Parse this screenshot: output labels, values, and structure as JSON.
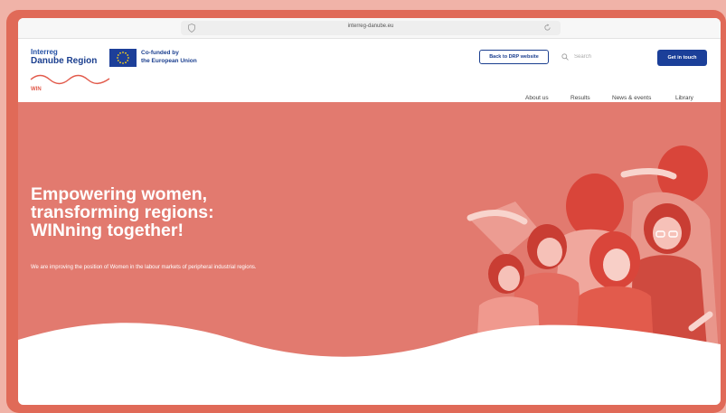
{
  "browser": {
    "url": "interreg-danube.eu"
  },
  "header": {
    "logo": {
      "line1": "Interreg",
      "line2": "Danube Region"
    },
    "eu_badge": {
      "line1": "Co-funded by",
      "line2": "the European Union"
    },
    "project_label": "WIN",
    "back_button": "Back to DRP website",
    "search_placeholder": "Search",
    "contact_button": "Get in touch",
    "nav": [
      "About us",
      "Results",
      "News & events",
      "Library"
    ]
  },
  "hero": {
    "title_line1": "Empowering women,",
    "title_line2": "transforming regions:",
    "title_line3": "WINning together!",
    "subtitle": "We are improving the position of Women in the labour markets of peripheral industrial regions."
  },
  "colors": {
    "frame": "#e06a58",
    "hero_bg": "#e27a6f",
    "brand_blue": "#1b3f99",
    "accent_red": "#e25b4c"
  }
}
